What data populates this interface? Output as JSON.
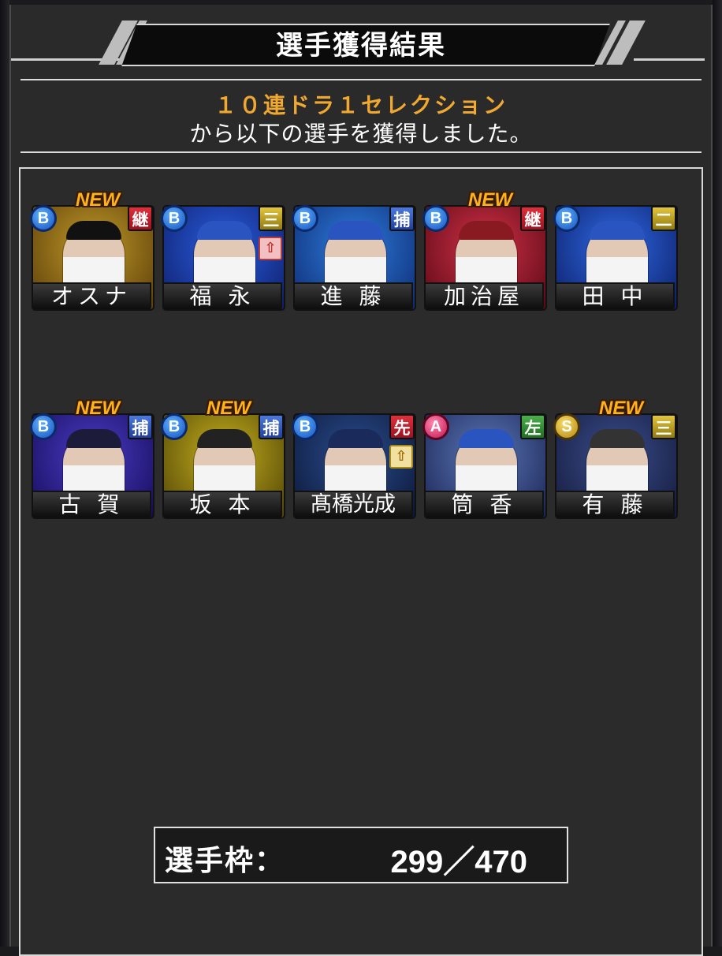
{
  "header": {
    "title": "選手獲得結果"
  },
  "message": {
    "line1": "１０連ドラ１セレクション",
    "line2": "から以下の選手を獲得しました。"
  },
  "players": [
    {
      "name": "オスナ",
      "rank": "B",
      "position": "継",
      "position_color": "red",
      "is_new": true,
      "new_label": "NEW",
      "upgrade": null,
      "art_colors": [
        "#c29a2a",
        "#5a3d08"
      ],
      "cap": "#111111"
    },
    {
      "name": "福 永",
      "rank": "B",
      "position": "三",
      "position_color": "yellow",
      "is_new": false,
      "new_label": "",
      "upgrade": "red",
      "art_colors": [
        "#2a5ee0",
        "#0e1e6a"
      ],
      "cap": "#2a55c0"
    },
    {
      "name": "進 藤",
      "rank": "B",
      "position": "捕",
      "position_color": "blue",
      "is_new": false,
      "new_label": "",
      "upgrade": null,
      "art_colors": [
        "#2e7ee0",
        "#0e2a70"
      ],
      "cap": "#2a55c0"
    },
    {
      "name": "加治屋",
      "rank": "B",
      "position": "継",
      "position_color": "red",
      "is_new": true,
      "new_label": "NEW",
      "upgrade": null,
      "art_colors": [
        "#d23248",
        "#5a0814"
      ],
      "cap": "#8a1a22"
    },
    {
      "name": "田 中",
      "rank": "B",
      "position": "二",
      "position_color": "yellow",
      "is_new": false,
      "new_label": "",
      "upgrade": null,
      "art_colors": [
        "#2f6be6",
        "#0c1d66"
      ],
      "cap": "#2a55c0"
    },
    {
      "name": "古 賀",
      "rank": "B",
      "position": "捕",
      "position_color": "blue",
      "is_new": true,
      "new_label": "NEW",
      "upgrade": null,
      "art_colors": [
        "#4c3cc8",
        "#140c58"
      ],
      "cap": "#1c1c3a"
    },
    {
      "name": "坂 本",
      "rank": "B",
      "position": "捕",
      "position_color": "blue",
      "is_new": true,
      "new_label": "NEW",
      "upgrade": null,
      "art_colors": [
        "#c9b21e",
        "#4e4306"
      ],
      "cap": "#222222"
    },
    {
      "name": "髙橋光成",
      "rank": "B",
      "position": "先",
      "position_color": "red",
      "is_new": false,
      "new_label": "",
      "upgrade": "gold",
      "art_colors": [
        "#2c4e90",
        "#0a1736"
      ],
      "cap": "#1a2a5a"
    },
    {
      "name": "筒 香",
      "rank": "A",
      "position": "左",
      "position_color": "green",
      "is_new": false,
      "new_label": "",
      "upgrade": null,
      "art_colors": [
        "#5c78b8",
        "#1a2454"
      ],
      "cap": "#2a55c0"
    },
    {
      "name": "有 藤",
      "rank": "S",
      "position": "三",
      "position_color": "yellow",
      "is_new": true,
      "new_label": "NEW",
      "upgrade": null,
      "art_colors": [
        "#3a4e8e",
        "#141a3a"
      ],
      "cap": "#333333"
    }
  ],
  "roster": {
    "label": "選手枠：",
    "value": "299／470"
  }
}
